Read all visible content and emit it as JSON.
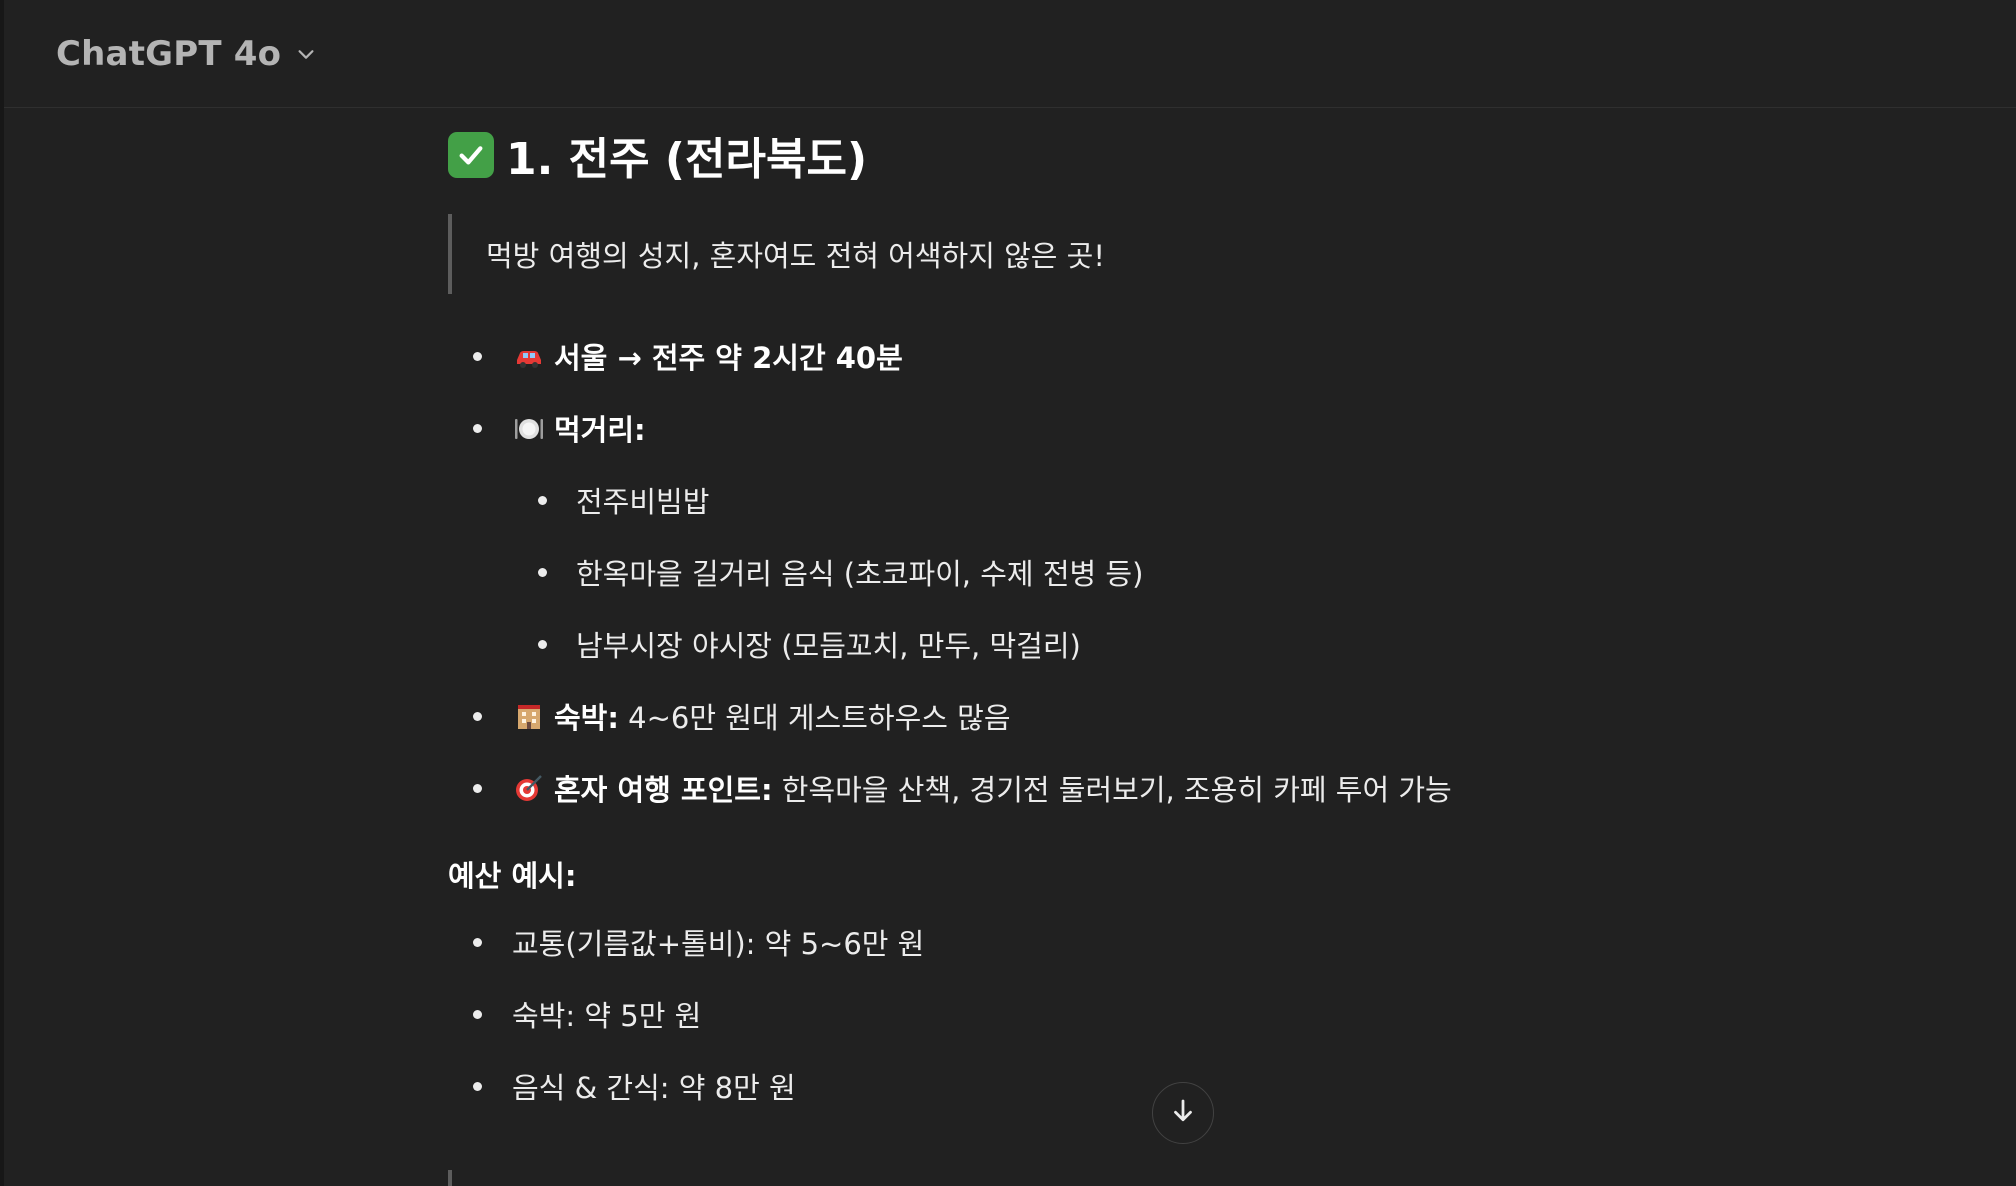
{
  "header": {
    "model_name": "ChatGPT 4o",
    "model_chevron_icon": "chevron-down-icon"
  },
  "section": {
    "heading_icon": "check-mark-icon",
    "heading": "1. 전주 (전라북도)",
    "quote": "먹방 여행의 성지, 혼자여도 전혀 어색하지 않은 곳!",
    "items": {
      "drive": {
        "icon": "car-icon",
        "text": "서울 → 전주 약 2시간 40분"
      },
      "food": {
        "icon": "plate-cutlery-icon",
        "label": "먹거리:",
        "subitems": [
          "전주비빔밥",
          "한옥마을 길거리 음식 (초코파이, 수제 전병 등)",
          "남부시장 야시장 (모듬꼬치, 만두, 막걸리)"
        ]
      },
      "stay": {
        "icon": "hotel-icon",
        "label": "숙박:",
        "text": " 4~6만 원대 게스트하우스 많음"
      },
      "solo": {
        "icon": "target-icon",
        "label": "혼자 여행 포인트:",
        "text": " 한옥마을 산책, 경기전 둘러보기, 조용히 카페 투어 가능"
      }
    }
  },
  "budget": {
    "title": "예산 예시:",
    "items": [
      "교통(기름값+톨비): 약 5~6만 원",
      "숙박: 약 5만 원",
      "음식 & 간식: 약 8만 원"
    ]
  },
  "controls": {
    "scroll_down_icon": "arrow-down-icon"
  },
  "colors": {
    "background": "#212121",
    "text": "#ececec",
    "muted": "#b4b4b4",
    "check_green": "#43a047",
    "quote_bar": "#5d5d5d"
  }
}
